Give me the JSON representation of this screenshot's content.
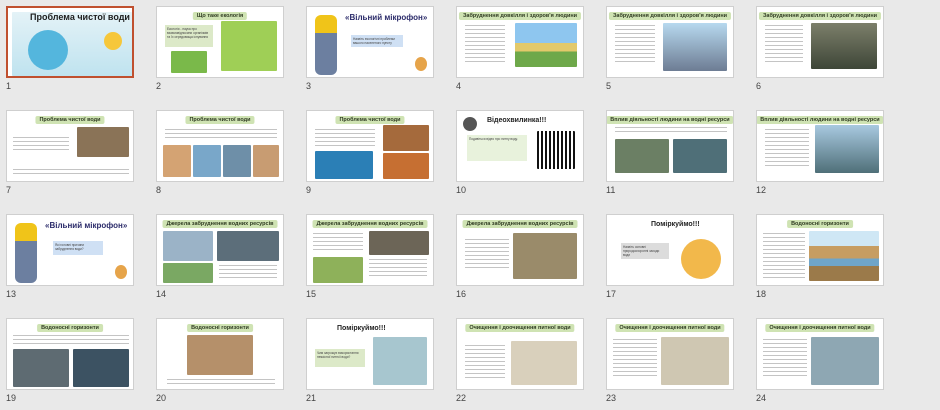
{
  "slides": [
    {
      "num": "1",
      "title": "Проблема чистої води",
      "selected": true
    },
    {
      "num": "2",
      "title": "Що таке екологія",
      "text": "Екологія - наука про взаємовідносини організмів та їх середовища існування"
    },
    {
      "num": "3",
      "title": "«Вільний мікрофон»",
      "text": "Назвіть екологічні проблеми вашого населеного пункту"
    },
    {
      "num": "4",
      "title": "Забруднення довкілля і здоров'я людини"
    },
    {
      "num": "5",
      "title": "Забруднення довкілля і здоров'я людини"
    },
    {
      "num": "6",
      "title": "Забруднення довкілля і здоров'я людини"
    },
    {
      "num": "7",
      "title": "Проблема чистої води"
    },
    {
      "num": "8",
      "title": "Проблема чистої води"
    },
    {
      "num": "9",
      "title": "Проблема чистої води"
    },
    {
      "num": "10",
      "title": "Відеохвилинка!!!",
      "text": "Подивіться відео про питну воду."
    },
    {
      "num": "11",
      "title": "Вплив діяльності людини на водні ресурси"
    },
    {
      "num": "12",
      "title": "Вплив діяльності людини на водні ресурси"
    },
    {
      "num": "13",
      "title": "«Вільний мікрофон»",
      "text": "Які головні причини забруднення води?"
    },
    {
      "num": "14",
      "title": "Джерела забруднення водних ресурсів"
    },
    {
      "num": "15",
      "title": "Джерела забруднення водних ресурсів"
    },
    {
      "num": "16",
      "title": "Джерела забруднення водних ресурсів"
    },
    {
      "num": "17",
      "title": "Поміркуймо!!!",
      "text": "Назвіть основні природоохоронні заходи води"
    },
    {
      "num": "18",
      "title": "Водоносні горизонти"
    },
    {
      "num": "19",
      "title": "Водоносні горизонти"
    },
    {
      "num": "20",
      "title": "Водоносні горизонти"
    },
    {
      "num": "21",
      "title": "Поміркуймо!!!",
      "text": "Чим загрожує використання неякісної питної води?"
    },
    {
      "num": "22",
      "title": "Очищення і доочищення питної води"
    },
    {
      "num": "23",
      "title": "Очищення і доочищення питної води"
    },
    {
      "num": "24",
      "title": "Очищення і доочищення питної води"
    }
  ],
  "colors": {
    "accent_selected": "#c0502f",
    "title_pill": "#cfe3b3",
    "background": "#e9e9e9"
  }
}
